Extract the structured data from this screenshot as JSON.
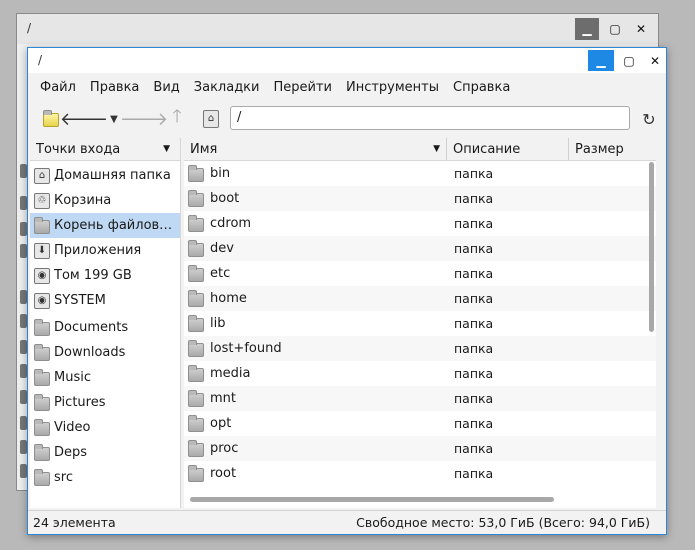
{
  "background_window": {
    "title": "/"
  },
  "window": {
    "title": "/"
  },
  "menu": [
    "Файл",
    "Правка",
    "Вид",
    "Закладки",
    "Перейти",
    "Инструменты",
    "Справка"
  ],
  "address": {
    "value": "/"
  },
  "sidebar": {
    "header": "Точки входа",
    "items": [
      {
        "label": "Домашняя папка",
        "icon": "home-icon"
      },
      {
        "label": "Корзина",
        "icon": "trash-icon"
      },
      {
        "label": "Корень файлов…",
        "icon": "folder-icon",
        "selected": true
      },
      {
        "label": "Приложения",
        "icon": "applications-icon"
      },
      {
        "label": "Том 199 GB",
        "icon": "drive-icon"
      },
      {
        "label": "SYSTEM",
        "icon": "drive-icon"
      },
      {
        "label": "Documents",
        "icon": "folder-icon"
      },
      {
        "label": "Downloads",
        "icon": "folder-icon"
      },
      {
        "label": "Music",
        "icon": "folder-icon"
      },
      {
        "label": "Pictures",
        "icon": "folder-icon"
      },
      {
        "label": "Video",
        "icon": "folder-icon"
      },
      {
        "label": "Deps",
        "icon": "folder-icon"
      },
      {
        "label": "src",
        "icon": "folder-icon"
      }
    ]
  },
  "columns": {
    "name": "Имя",
    "description": "Описание",
    "size": "Размер"
  },
  "files": [
    {
      "name": "bin",
      "description": "папка"
    },
    {
      "name": "boot",
      "description": "папка"
    },
    {
      "name": "cdrom",
      "description": "папка"
    },
    {
      "name": "dev",
      "description": "папка"
    },
    {
      "name": "etc",
      "description": "папка"
    },
    {
      "name": "home",
      "description": "папка"
    },
    {
      "name": "lib",
      "description": "папка"
    },
    {
      "name": "lost+found",
      "description": "папка"
    },
    {
      "name": "media",
      "description": "папка"
    },
    {
      "name": "mnt",
      "description": "папка"
    },
    {
      "name": "opt",
      "description": "папка"
    },
    {
      "name": "proc",
      "description": "папка"
    },
    {
      "name": "root",
      "description": "папка"
    }
  ],
  "status": {
    "count": "24 элемента",
    "space": "Свободное место: 53,0 ГиБ (Всего: 94,0 ГиБ)"
  },
  "colors": {
    "accent": "#1e88e5",
    "selection": "#bfd8f3"
  }
}
